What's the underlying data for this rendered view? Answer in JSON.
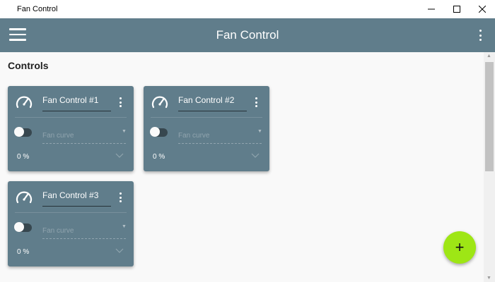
{
  "window": {
    "title": "Fan Control"
  },
  "appbar": {
    "title": "Fan Control",
    "menu_icon": "hamburger-icon",
    "more_icon": "more-vertical-icon"
  },
  "section": {
    "title": "Controls"
  },
  "cards": [
    {
      "name": "Fan Control #1",
      "curve_placeholder": "Fan curve",
      "percent": "0 %",
      "enabled": false
    },
    {
      "name": "Fan Control #2",
      "curve_placeholder": "Fan curve",
      "percent": "0 %",
      "enabled": false
    },
    {
      "name": "Fan Control #3",
      "curve_placeholder": "Fan curve",
      "percent": "0 %",
      "enabled": false
    }
  ],
  "fab": {
    "label": "+",
    "color": "#9ee615"
  },
  "colors": {
    "primary": "#607d8b",
    "accent": "#9ee615"
  }
}
